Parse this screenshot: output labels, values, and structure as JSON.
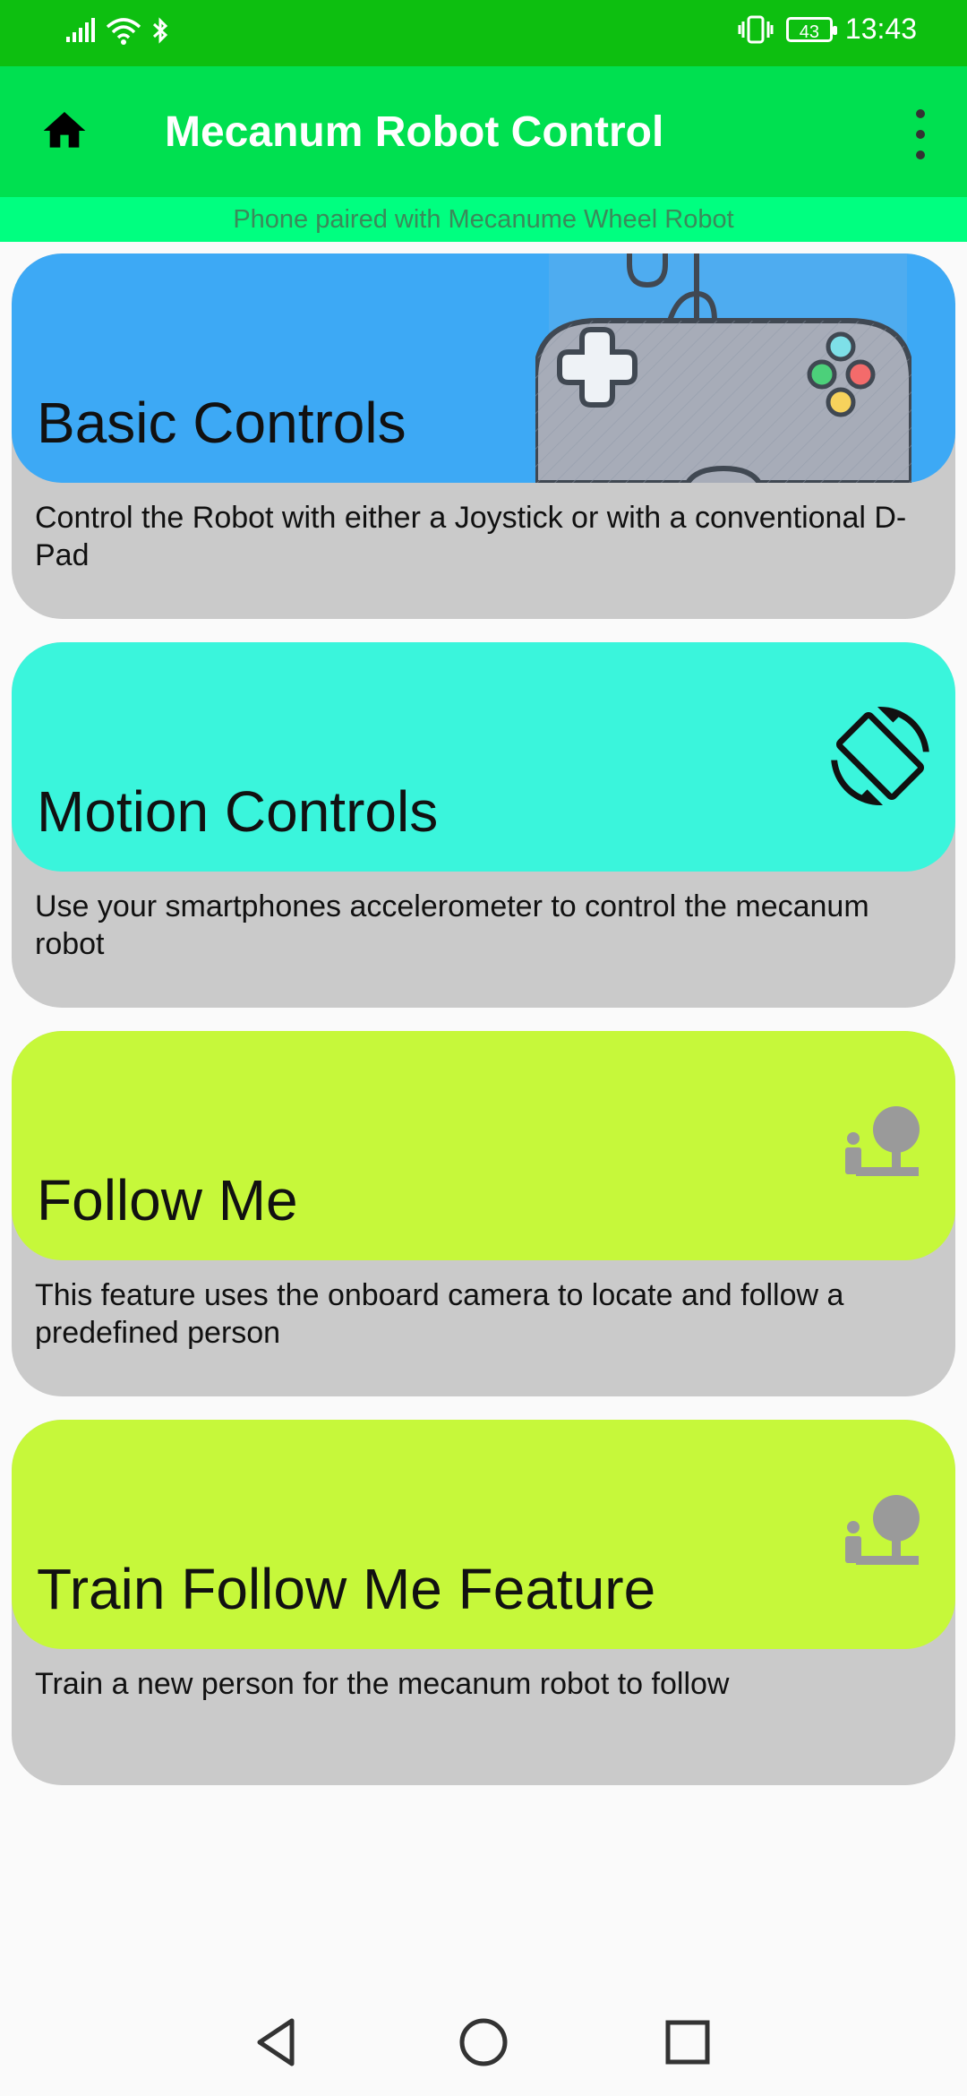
{
  "status_bar": {
    "time": "13:43",
    "battery": "43",
    "icons": [
      "signal-icon",
      "wifi-icon",
      "bluetooth-icon",
      "vibrate-icon",
      "battery-icon"
    ]
  },
  "app_bar": {
    "title": "Mecanum Robot Control",
    "home_icon": "home-icon",
    "menu_icon": "more-vert-icon"
  },
  "connection_status": "Phone paired with Mecanume Wheel Robot",
  "cards": [
    {
      "title": "Basic Controls",
      "description": "Control the Robot with either a Joystick or with a conventional D-Pad",
      "color": "#3da9f5",
      "icon": "gamepad-icon"
    },
    {
      "title": "Motion Controls",
      "description": "Use your smartphones accelerometer to control the mecanum robot",
      "color": "#3af5dc",
      "icon": "screen-rotation-icon"
    },
    {
      "title": "Follow Me",
      "description": "This feature uses the onboard camera to locate and follow a predefined person",
      "color": "#c6f83a",
      "icon": "follow-person-icon"
    },
    {
      "title": "Train Follow Me Feature",
      "description": "Train a new person for the mecanum robot to follow",
      "color": "#c6f83a",
      "icon": "follow-person-icon"
    }
  ],
  "navigation": {
    "back_icon": "back-icon",
    "home_icon": "home-circle-icon",
    "recents_icon": "recents-icon"
  }
}
